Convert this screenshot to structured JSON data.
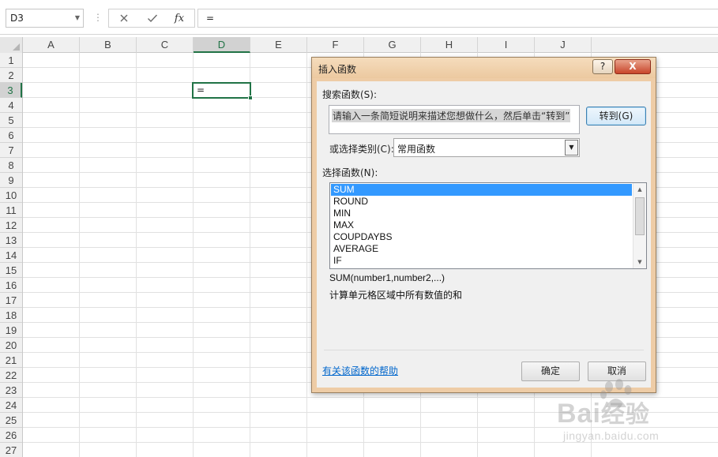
{
  "formula_bar": {
    "name_box": "D3",
    "cancel_icon": "cancel-x-icon",
    "enter_icon": "checkmark-icon",
    "function_label": "fx",
    "formula": "="
  },
  "sheet": {
    "columns": [
      "A",
      "B",
      "C",
      "D",
      "E",
      "F",
      "G",
      "H",
      "I",
      "J"
    ],
    "rows": [
      "1",
      "2",
      "3",
      "4",
      "5",
      "6",
      "7",
      "8",
      "9",
      "10",
      "11",
      "12",
      "13",
      "14",
      "15",
      "16",
      "17",
      "18",
      "19",
      "20",
      "21",
      "22",
      "23",
      "24",
      "25",
      "26",
      "27"
    ],
    "active_cell": {
      "ref": "D3",
      "value": "="
    },
    "selected_column": "D",
    "selected_row": "3",
    "accent_color": "#217346"
  },
  "dialog": {
    "title": "插入函数",
    "help_button": "?",
    "close_button": "X",
    "search_label": "搜索函数(S):",
    "search_text": "请输入一条简短说明来描述您想做什么，然后单击“转到”",
    "go_button": "转到(G)",
    "category_label": "或选择类别(C):",
    "category_value": "常用函数",
    "functions_label": "选择函数(N):",
    "functions": [
      "SUM",
      "ROUND",
      "MIN",
      "MAX",
      "COUPDAYBS",
      "AVERAGE",
      "IF"
    ],
    "selected_function": "SUM",
    "syntax": "SUM(number1,number2,...)",
    "description": "计算单元格区域中所有数值的和",
    "help_link": "有关该函数的帮助",
    "ok_button": "确定",
    "cancel_button": "取消",
    "frame_color": "#eecca6",
    "selection_color": "#3399ff"
  },
  "watermark": {
    "line1": "Bai",
    "line1_suffix": "经验",
    "line2": "jingyan.baidu.com"
  }
}
